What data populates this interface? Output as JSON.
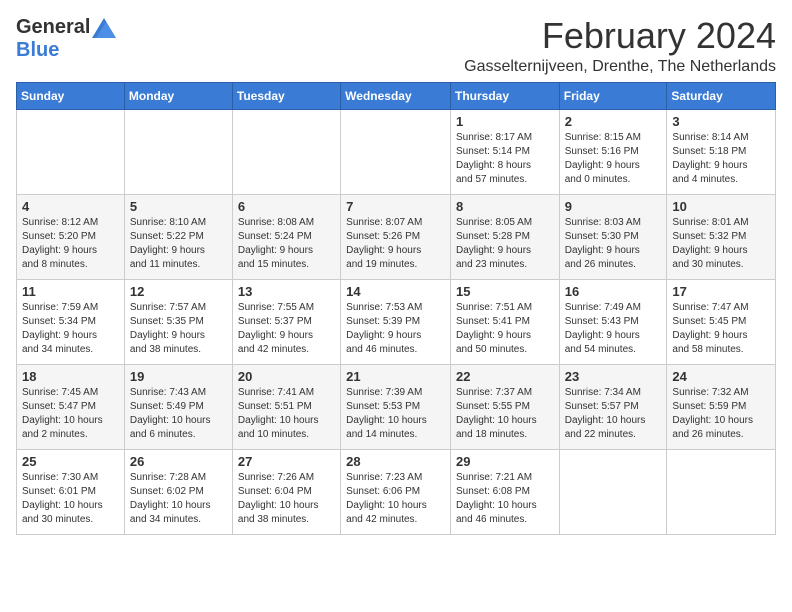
{
  "logo": {
    "general": "General",
    "blue": "Blue"
  },
  "title": "February 2024",
  "location": "Gasselternijveen, Drenthe, The Netherlands",
  "days_of_week": [
    "Sunday",
    "Monday",
    "Tuesday",
    "Wednesday",
    "Thursday",
    "Friday",
    "Saturday"
  ],
  "weeks": [
    [
      {
        "day": "",
        "info": ""
      },
      {
        "day": "",
        "info": ""
      },
      {
        "day": "",
        "info": ""
      },
      {
        "day": "",
        "info": ""
      },
      {
        "day": "1",
        "info": "Sunrise: 8:17 AM\nSunset: 5:14 PM\nDaylight: 8 hours\nand 57 minutes."
      },
      {
        "day": "2",
        "info": "Sunrise: 8:15 AM\nSunset: 5:16 PM\nDaylight: 9 hours\nand 0 minutes."
      },
      {
        "day": "3",
        "info": "Sunrise: 8:14 AM\nSunset: 5:18 PM\nDaylight: 9 hours\nand 4 minutes."
      }
    ],
    [
      {
        "day": "4",
        "info": "Sunrise: 8:12 AM\nSunset: 5:20 PM\nDaylight: 9 hours\nand 8 minutes."
      },
      {
        "day": "5",
        "info": "Sunrise: 8:10 AM\nSunset: 5:22 PM\nDaylight: 9 hours\nand 11 minutes."
      },
      {
        "day": "6",
        "info": "Sunrise: 8:08 AM\nSunset: 5:24 PM\nDaylight: 9 hours\nand 15 minutes."
      },
      {
        "day": "7",
        "info": "Sunrise: 8:07 AM\nSunset: 5:26 PM\nDaylight: 9 hours\nand 19 minutes."
      },
      {
        "day": "8",
        "info": "Sunrise: 8:05 AM\nSunset: 5:28 PM\nDaylight: 9 hours\nand 23 minutes."
      },
      {
        "day": "9",
        "info": "Sunrise: 8:03 AM\nSunset: 5:30 PM\nDaylight: 9 hours\nand 26 minutes."
      },
      {
        "day": "10",
        "info": "Sunrise: 8:01 AM\nSunset: 5:32 PM\nDaylight: 9 hours\nand 30 minutes."
      }
    ],
    [
      {
        "day": "11",
        "info": "Sunrise: 7:59 AM\nSunset: 5:34 PM\nDaylight: 9 hours\nand 34 minutes."
      },
      {
        "day": "12",
        "info": "Sunrise: 7:57 AM\nSunset: 5:35 PM\nDaylight: 9 hours\nand 38 minutes."
      },
      {
        "day": "13",
        "info": "Sunrise: 7:55 AM\nSunset: 5:37 PM\nDaylight: 9 hours\nand 42 minutes."
      },
      {
        "day": "14",
        "info": "Sunrise: 7:53 AM\nSunset: 5:39 PM\nDaylight: 9 hours\nand 46 minutes."
      },
      {
        "day": "15",
        "info": "Sunrise: 7:51 AM\nSunset: 5:41 PM\nDaylight: 9 hours\nand 50 minutes."
      },
      {
        "day": "16",
        "info": "Sunrise: 7:49 AM\nSunset: 5:43 PM\nDaylight: 9 hours\nand 54 minutes."
      },
      {
        "day": "17",
        "info": "Sunrise: 7:47 AM\nSunset: 5:45 PM\nDaylight: 9 hours\nand 58 minutes."
      }
    ],
    [
      {
        "day": "18",
        "info": "Sunrise: 7:45 AM\nSunset: 5:47 PM\nDaylight: 10 hours\nand 2 minutes."
      },
      {
        "day": "19",
        "info": "Sunrise: 7:43 AM\nSunset: 5:49 PM\nDaylight: 10 hours\nand 6 minutes."
      },
      {
        "day": "20",
        "info": "Sunrise: 7:41 AM\nSunset: 5:51 PM\nDaylight: 10 hours\nand 10 minutes."
      },
      {
        "day": "21",
        "info": "Sunrise: 7:39 AM\nSunset: 5:53 PM\nDaylight: 10 hours\nand 14 minutes."
      },
      {
        "day": "22",
        "info": "Sunrise: 7:37 AM\nSunset: 5:55 PM\nDaylight: 10 hours\nand 18 minutes."
      },
      {
        "day": "23",
        "info": "Sunrise: 7:34 AM\nSunset: 5:57 PM\nDaylight: 10 hours\nand 22 minutes."
      },
      {
        "day": "24",
        "info": "Sunrise: 7:32 AM\nSunset: 5:59 PM\nDaylight: 10 hours\nand 26 minutes."
      }
    ],
    [
      {
        "day": "25",
        "info": "Sunrise: 7:30 AM\nSunset: 6:01 PM\nDaylight: 10 hours\nand 30 minutes."
      },
      {
        "day": "26",
        "info": "Sunrise: 7:28 AM\nSunset: 6:02 PM\nDaylight: 10 hours\nand 34 minutes."
      },
      {
        "day": "27",
        "info": "Sunrise: 7:26 AM\nSunset: 6:04 PM\nDaylight: 10 hours\nand 38 minutes."
      },
      {
        "day": "28",
        "info": "Sunrise: 7:23 AM\nSunset: 6:06 PM\nDaylight: 10 hours\nand 42 minutes."
      },
      {
        "day": "29",
        "info": "Sunrise: 7:21 AM\nSunset: 6:08 PM\nDaylight: 10 hours\nand 46 minutes."
      },
      {
        "day": "",
        "info": ""
      },
      {
        "day": "",
        "info": ""
      }
    ]
  ]
}
